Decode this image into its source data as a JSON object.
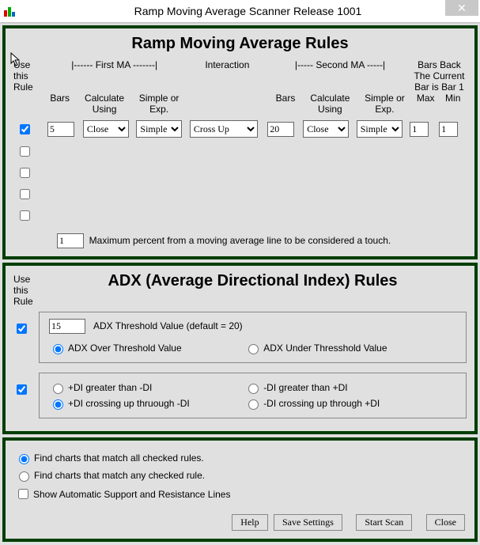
{
  "titlebar": {
    "text": "Ramp Moving Average Scanner    Release 1001"
  },
  "panel1": {
    "heading": "Ramp Moving Average Rules",
    "cols": {
      "usethisrule": "Use this Rule",
      "firstma": "|------ First MA -------|",
      "interaction": "Interaction",
      "secondma": "|----- Second MA -----|",
      "barsback": "Bars Back The Current Bar is Bar 1",
      "bars": "Bars",
      "calcusing": "Calculate Using",
      "simpleexp": "Simple or Exp.",
      "max": "Max",
      "min": "Min"
    },
    "row": {
      "checked": true,
      "bars1": "5",
      "calc1": "Close",
      "type1": "Simple",
      "inter": "Cross Up",
      "bars2": "20",
      "calc2": "Close",
      "type2": "Simple",
      "max": "1",
      "min": "1"
    },
    "touchpct": "1",
    "touchlabel": "Maximum percent from a moving average line to be considered a touch."
  },
  "panel2": {
    "heading": "ADX (Average Directional Index) Rules",
    "usethisrule": "Use this Rule",
    "adxVal": "15",
    "adxThreshLabel": "ADX Threshold Value (default = 20)",
    "r1a": "ADX Over Threshold Value",
    "r1b": "ADX Under Thresshold Value",
    "r2a": "+DI greater than -DI",
    "r2b": "-DI greater than +DI",
    "r2c": "+DI crossing up thruough -DI",
    "r2d": "-DI crossing up through +DI",
    "chk1": true,
    "chk2": true
  },
  "panel3": {
    "matchAll": "Find charts that match all checked rules.",
    "matchAny": "Find charts that match any checked rule.",
    "showLines": "Show Automatic Support and Resistance Lines",
    "btnHelp": "Help",
    "btnSave": "Save Settings",
    "btnScan": "Start Scan",
    "btnClose": "Close"
  },
  "opts": {
    "calc": [
      "Close"
    ],
    "type": [
      "Simple"
    ],
    "inter": [
      "Cross Up"
    ]
  }
}
